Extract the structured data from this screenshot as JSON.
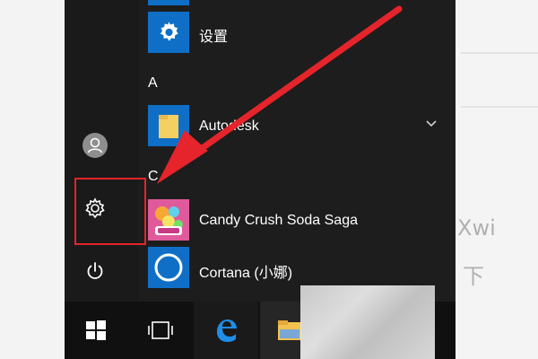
{
  "apps": [
    {
      "label": "设置"
    },
    {
      "label": "Autodesk"
    },
    {
      "label": "Candy Crush Soda Saga"
    },
    {
      "label": "Cortana (小娜)"
    }
  ],
  "sections": [
    "A",
    "C"
  ],
  "background_text": {
    "line1": "Xwi",
    "line2": "下"
  },
  "icons": {
    "rail": [
      "user-avatar-icon",
      "settings-gear-icon",
      "power-icon"
    ],
    "taskbar": [
      "windows-start-icon",
      "task-view-icon",
      "edge-icon",
      "file-explorer-icon"
    ]
  },
  "colors": {
    "accent_blue": "#0f6fc6",
    "annotation_red": "#e5242b",
    "menu_bg": "#1d1d1d"
  }
}
